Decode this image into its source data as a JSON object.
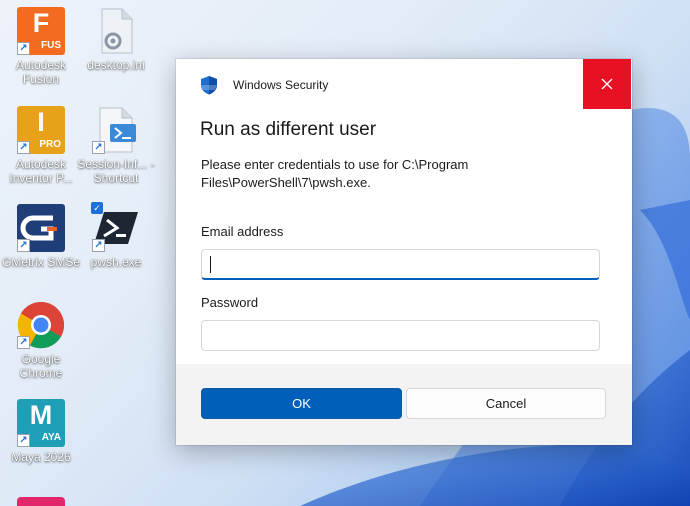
{
  "desktop": {
    "icons": [
      {
        "label": "Autodesk Fusion",
        "letter": "F",
        "badge": "FUS",
        "color": "#f26b21"
      },
      {
        "label": "desktop.ini"
      },
      {
        "label": "Autodesk Inventor P...",
        "letter": "I",
        "badge": "PRO",
        "color": "#e8a21a"
      },
      {
        "label": "Session-Inf... - Shortcut"
      },
      {
        "label": "GMetrix SMSe",
        "color": "#1f3d78"
      },
      {
        "label": "pwsh.exe"
      },
      {
        "label": "Google Chrome"
      },
      {
        "label": "Maya 2026",
        "letter": "M",
        "badge": "AYA",
        "color": "#1f9fb7"
      }
    ]
  },
  "dialog": {
    "app_title": "Windows Security",
    "heading": "Run as different user",
    "description": "Please enter credentials to use for C:\\Program Files\\PowerShell\\7\\pwsh.exe.",
    "email_label": "Email address",
    "email_value": "",
    "password_label": "Password",
    "password_value": "",
    "ok_label": "OK",
    "cancel_label": "Cancel",
    "accent_color": "#005fb8",
    "close_color": "#e81123"
  }
}
